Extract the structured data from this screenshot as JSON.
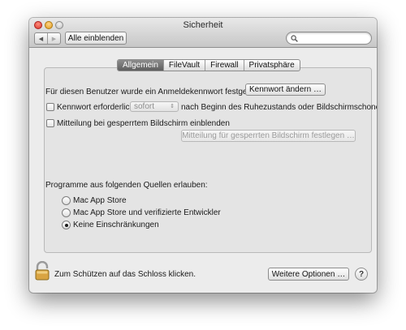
{
  "window": {
    "title": "Sicherheit",
    "show_all_label": "Alle einblenden",
    "search_placeholder": ""
  },
  "tabs": [
    {
      "label": "Allgemein",
      "active": true
    },
    {
      "label": "FileVault",
      "active": false
    },
    {
      "label": "Firewall",
      "active": false
    },
    {
      "label": "Privatsphäre",
      "active": false
    }
  ],
  "general": {
    "login_password_text": "Für diesen Benutzer wurde ein Anmeldekennwort festgelegt",
    "change_password_label": "Kennwort ändern …",
    "require_password_label": "Kennwort erforderlich",
    "require_password_checked": false,
    "require_password_delay": "sofort",
    "require_password_suffix": "nach Beginn des Ruhezustands oder Bildschirmschoners",
    "lock_message_label": "Mitteilung bei gesperrtem Bildschirm einblenden",
    "lock_message_checked": false,
    "set_lock_message_label": "Mitteilung für gesperrten Bildschirm festlegen …"
  },
  "sources": {
    "heading": "Programme aus folgenden Quellen erlauben:",
    "options": [
      {
        "label": "Mac App Store",
        "selected": false
      },
      {
        "label": "Mac App Store und verifizierte Entwickler",
        "selected": false
      },
      {
        "label": "Keine Einschränkungen",
        "selected": true
      }
    ]
  },
  "footer": {
    "lock_text": "Zum Schützen auf das Schloss klicken.",
    "advanced_label": "Weitere Optionen …",
    "help_label": "?"
  },
  "colors": {
    "active_tab": "#6f6f6f",
    "window_bg": "#ececec",
    "lock_gold": "#d9a441"
  },
  "icons": [
    "back-arrow-icon",
    "forward-arrow-icon",
    "search-icon",
    "lock-icon",
    "help-icon"
  ]
}
